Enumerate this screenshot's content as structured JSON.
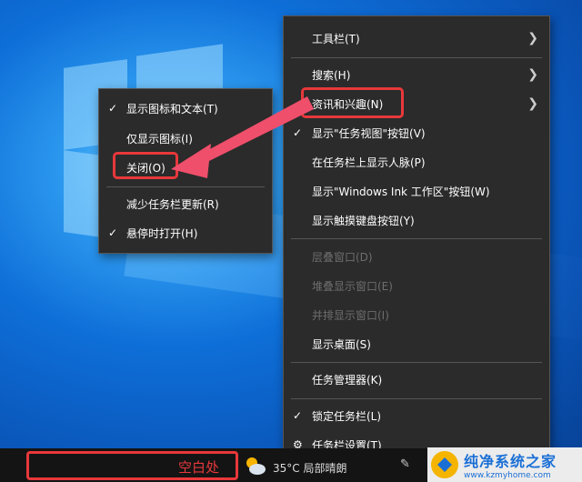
{
  "main_menu": {
    "toolbar": "工具栏(T)",
    "search": "搜索(H)",
    "news": "资讯和兴趣(N)",
    "task_view": "显示\"任务视图\"按钮(V)",
    "people": "在任务栏上显示人脉(P)",
    "ink": "显示\"Windows Ink 工作区\"按钮(W)",
    "touch_keyboard": "显示触摸键盘按钮(Y)",
    "cascade": "层叠窗口(D)",
    "stacked": "堆叠显示窗口(E)",
    "side_by_side": "并排显示窗口(I)",
    "show_desktop": "显示桌面(S)",
    "task_manager": "任务管理器(K)",
    "lock_taskbar": "锁定任务栏(L)",
    "taskbar_settings": "任务栏设置(T)"
  },
  "sub_menu": {
    "icon_and_text": "显示图标和文本(T)",
    "icon_only": "仅显示图标(I)",
    "close": "关闭(O)",
    "reduce_updates": "减少任务栏更新(R)",
    "hover_open": "悬停时打开(H)"
  },
  "taskbar": {
    "blank_label": "空白处",
    "weather": "35°C 局部晴朗"
  },
  "watermark": {
    "title": "纯净系统之家",
    "url": "www.kzmyhome.com"
  },
  "colors": {
    "highlight": "#e8383b",
    "menu_bg": "#2b2b2b"
  }
}
